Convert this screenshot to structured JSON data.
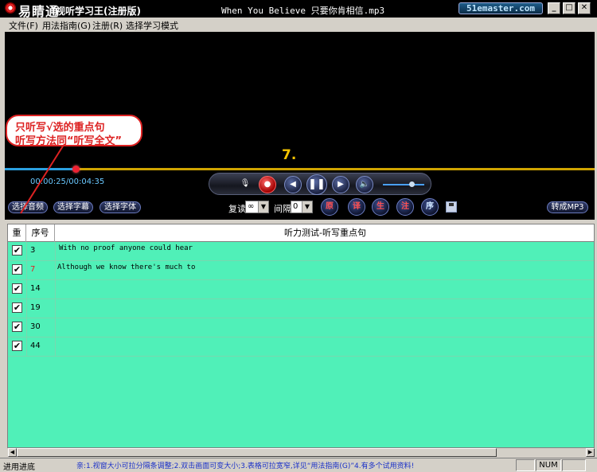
{
  "titlebar": {
    "app_name": "易睛通",
    "app_subtitle": "视听学习王(注册版)",
    "window_title": "When You Believe 只要你肯相信.mp3",
    "brand_badge": "51emaster.com",
    "minimize_glyph": "_",
    "maximize_glyph": "□",
    "close_glyph": "✕"
  },
  "menu": [
    "文件(F)",
    "用法指南(G)",
    "注册(R)",
    "选择学习模式"
  ],
  "callout": {
    "line1": "只听写√选的重点句",
    "line2": "听写方法同“听写全文”"
  },
  "player": {
    "current_sentence": "7.",
    "time_readout": "00:00:25/00:04:35",
    "progress_fraction": 0.12,
    "volume_fraction": 0.7,
    "buttons": [
      "microphone-icon",
      "record-icon",
      "previous-icon",
      "pause-icon",
      "next-icon",
      "speaker-icon"
    ]
  },
  "controls": {
    "select_audio": "选择音频",
    "select_subtitle": "选择字幕",
    "select_font": "选择字体",
    "repeat_label": "复读",
    "repeat_value": "∞",
    "interval_label": "间隔",
    "interval_value": "0",
    "mode_buttons": [
      "原",
      "译",
      "生",
      "注",
      "序"
    ],
    "convert_mp3": "转成MP3"
  },
  "table": {
    "headers": {
      "check": "重",
      "index": "序号",
      "content": "听力测试-听写重点句"
    },
    "rows": [
      {
        "checked": true,
        "num": "3",
        "text": "With no proof anyone could hear"
      },
      {
        "checked": true,
        "num": "7",
        "text": "Although we know there's much to"
      },
      {
        "checked": true,
        "num": "14",
        "text": ""
      },
      {
        "checked": true,
        "num": "19",
        "text": ""
      },
      {
        "checked": true,
        "num": "30",
        "text": ""
      },
      {
        "checked": true,
        "num": "44",
        "text": ""
      }
    ]
  },
  "statusbar": {
    "left": "进用进底",
    "tip": "亲:1.视窗大小可拉分隔条调整;2.双击画面可变大小;3.表格可拉宽窄,详见“用法指南(G)”4.有多个试用资料!",
    "num": "NUM"
  },
  "colors": {
    "table_bg": "#50f0b8",
    "callout_red": "#dd2222",
    "progress_yellow": "#cfa400",
    "sentence_num": "#f5c400"
  }
}
